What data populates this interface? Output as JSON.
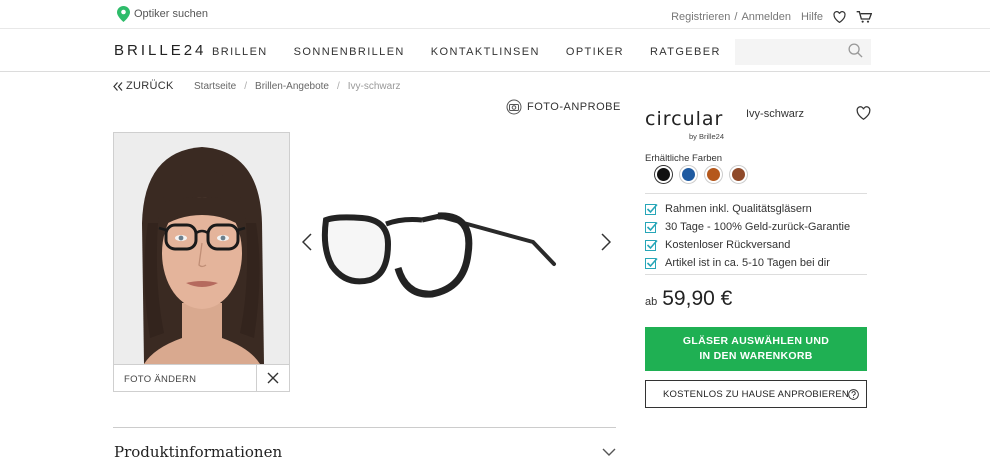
{
  "topbar": {
    "store_finder": "Optiker suchen",
    "register": "Registrieren",
    "separator": "/",
    "login": "Anmelden",
    "help": "Hilfe",
    "icons": [
      "map-pin-icon",
      "heart-icon",
      "cart-icon"
    ]
  },
  "header": {
    "logo": "BRILLE24",
    "nav": [
      "BRILLEN",
      "SONNENBRILLEN",
      "KONTAKTLINSEN",
      "OPTIKER",
      "RATGEBER"
    ],
    "search_placeholder": ""
  },
  "breadcrumb": {
    "back": "ZURÜCK",
    "items": [
      "Startseite",
      "Brillen-Angebote",
      "Ivy-schwarz"
    ]
  },
  "gallery": {
    "try_on": "FOTO-ANPROBE",
    "change_photo": "FOTO ÄNDERN"
  },
  "product": {
    "brand": "circular",
    "brand_sub": "by Brille24",
    "name": "Ivy-schwarz",
    "colors_label": "Erhältliche Farben",
    "colors": [
      "#111111",
      "#1f5aa0",
      "#b5581c",
      "#8f4a2a"
    ],
    "selected_color": 0,
    "benefits": [
      "Rahmen inkl. Qualitätsgläsern",
      "30 Tage - 100% Geld-zurück-Garantie",
      "Kostenloser Rückversand",
      "Artikel ist in ca. 5-10 Tagen bei dir"
    ],
    "price_prefix": "ab",
    "price": "59,90 €",
    "cta_line1": "GLÄSER AUSWÄHLEN UND",
    "cta_line2": "IN DEN WARENKORB",
    "home_try": "KOSTENLOS ZU HAUSE ANPROBIEREN"
  },
  "sections": {
    "product_info": "Produktinformationen"
  },
  "colors": {
    "accent_green": "#1fb053",
    "pin_green": "#2ebc6a",
    "check_teal": "#27a6b8"
  }
}
